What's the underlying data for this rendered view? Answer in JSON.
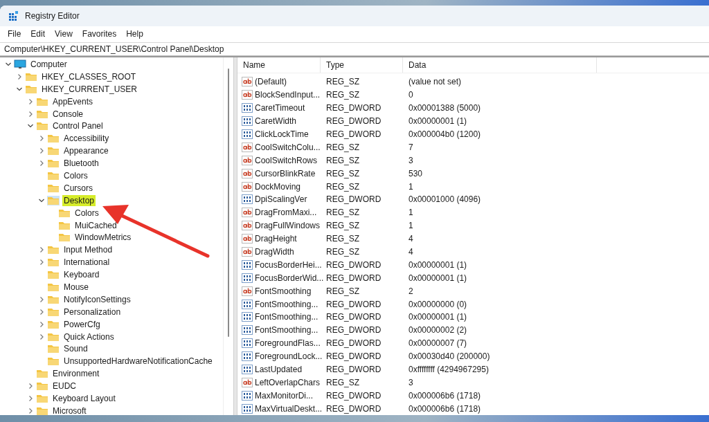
{
  "window": {
    "title": "Registry Editor"
  },
  "menu": [
    "File",
    "Edit",
    "View",
    "Favorites",
    "Help"
  ],
  "address": "Computer\\HKEY_CURRENT_USER\\Control Panel\\Desktop",
  "tree": [
    {
      "label": "Computer",
      "kind": "computer",
      "has_children": true,
      "expanded": true,
      "selected": false,
      "children": [
        {
          "label": "HKEY_CLASSES_ROOT",
          "kind": "folder",
          "has_children": true,
          "expanded": false,
          "selected": false
        },
        {
          "label": "HKEY_CURRENT_USER",
          "kind": "folder",
          "has_children": true,
          "expanded": true,
          "selected": false,
          "children": [
            {
              "label": "AppEvents",
              "kind": "folder",
              "has_children": true,
              "expanded": false,
              "selected": false
            },
            {
              "label": "Console",
              "kind": "folder",
              "has_children": true,
              "expanded": false,
              "selected": false
            },
            {
              "label": "Control Panel",
              "kind": "folder",
              "has_children": true,
              "expanded": true,
              "selected": false,
              "children": [
                {
                  "label": "Accessibility",
                  "kind": "folder",
                  "has_children": true,
                  "expanded": false,
                  "selected": false
                },
                {
                  "label": "Appearance",
                  "kind": "folder",
                  "has_children": true,
                  "expanded": false,
                  "selected": false
                },
                {
                  "label": "Bluetooth",
                  "kind": "folder",
                  "has_children": true,
                  "expanded": false,
                  "selected": false
                },
                {
                  "label": "Colors",
                  "kind": "folder",
                  "has_children": false,
                  "selected": false
                },
                {
                  "label": "Cursors",
                  "kind": "folder",
                  "has_children": false,
                  "selected": false
                },
                {
                  "label": "Desktop",
                  "kind": "folder",
                  "has_children": true,
                  "expanded": true,
                  "selected": true,
                  "children": [
                    {
                      "label": "Colors",
                      "kind": "folder",
                      "has_children": false,
                      "selected": false
                    },
                    {
                      "label": "MuiCached",
                      "kind": "folder",
                      "has_children": false,
                      "selected": false
                    },
                    {
                      "label": "WindowMetrics",
                      "kind": "folder",
                      "has_children": false,
                      "selected": false
                    }
                  ]
                },
                {
                  "label": "Input Method",
                  "kind": "folder",
                  "has_children": true,
                  "expanded": false,
                  "selected": false
                },
                {
                  "label": "International",
                  "kind": "folder",
                  "has_children": true,
                  "expanded": false,
                  "selected": false
                },
                {
                  "label": "Keyboard",
                  "kind": "folder",
                  "has_children": false,
                  "selected": false
                },
                {
                  "label": "Mouse",
                  "kind": "folder",
                  "has_children": false,
                  "selected": false
                },
                {
                  "label": "NotifyIconSettings",
                  "kind": "folder",
                  "has_children": true,
                  "expanded": false,
                  "selected": false
                },
                {
                  "label": "Personalization",
                  "kind": "folder",
                  "has_children": true,
                  "expanded": false,
                  "selected": false
                },
                {
                  "label": "PowerCfg",
                  "kind": "folder",
                  "has_children": true,
                  "expanded": false,
                  "selected": false
                },
                {
                  "label": "Quick Actions",
                  "kind": "folder",
                  "has_children": true,
                  "expanded": false,
                  "selected": false
                },
                {
                  "label": "Sound",
                  "kind": "folder",
                  "has_children": false,
                  "selected": false
                },
                {
                  "label": "UnsupportedHardwareNotificationCache",
                  "kind": "folder",
                  "has_children": false,
                  "selected": false
                }
              ]
            },
            {
              "label": "Environment",
              "kind": "folder",
              "has_children": false,
              "selected": false
            },
            {
              "label": "EUDC",
              "kind": "folder",
              "has_children": true,
              "expanded": false,
              "selected": false
            },
            {
              "label": "Keyboard Layout",
              "kind": "folder",
              "has_children": true,
              "expanded": false,
              "selected": false
            },
            {
              "label": "Microsoft",
              "kind": "folder",
              "has_children": true,
              "expanded": false,
              "selected": false
            }
          ]
        }
      ]
    }
  ],
  "table": {
    "columns": [
      "Name",
      "Type",
      "Data"
    ],
    "rows": [
      {
        "kind": "string",
        "name": "(Default)",
        "type": "REG_SZ",
        "data": "(value not set)"
      },
      {
        "kind": "string",
        "name": "BlockSendInput...",
        "type": "REG_SZ",
        "data": "0"
      },
      {
        "kind": "dword",
        "name": "CaretTimeout",
        "type": "REG_DWORD",
        "data": "0x00001388 (5000)"
      },
      {
        "kind": "dword",
        "name": "CaretWidth",
        "type": "REG_DWORD",
        "data": "0x00000001 (1)"
      },
      {
        "kind": "dword",
        "name": "ClickLockTime",
        "type": "REG_DWORD",
        "data": "0x000004b0 (1200)"
      },
      {
        "kind": "string",
        "name": "CoolSwitchColu...",
        "type": "REG_SZ",
        "data": "7"
      },
      {
        "kind": "string",
        "name": "CoolSwitchRows",
        "type": "REG_SZ",
        "data": "3"
      },
      {
        "kind": "string",
        "name": "CursorBlinkRate",
        "type": "REG_SZ",
        "data": "530"
      },
      {
        "kind": "string",
        "name": "DockMoving",
        "type": "REG_SZ",
        "data": "1"
      },
      {
        "kind": "dword",
        "name": "DpiScalingVer",
        "type": "REG_DWORD",
        "data": "0x00001000 (4096)"
      },
      {
        "kind": "string",
        "name": "DragFromMaxi...",
        "type": "REG_SZ",
        "data": "1"
      },
      {
        "kind": "string",
        "name": "DragFullWindows",
        "type": "REG_SZ",
        "data": "1"
      },
      {
        "kind": "string",
        "name": "DragHeight",
        "type": "REG_SZ",
        "data": "4"
      },
      {
        "kind": "string",
        "name": "DragWidth",
        "type": "REG_SZ",
        "data": "4"
      },
      {
        "kind": "dword",
        "name": "FocusBorderHei...",
        "type": "REG_DWORD",
        "data": "0x00000001 (1)"
      },
      {
        "kind": "dword",
        "name": "FocusBorderWid...",
        "type": "REG_DWORD",
        "data": "0x00000001 (1)"
      },
      {
        "kind": "string",
        "name": "FontSmoothing",
        "type": "REG_SZ",
        "data": "2"
      },
      {
        "kind": "dword",
        "name": "FontSmoothing...",
        "type": "REG_DWORD",
        "data": "0x00000000 (0)"
      },
      {
        "kind": "dword",
        "name": "FontSmoothing...",
        "type": "REG_DWORD",
        "data": "0x00000001 (1)"
      },
      {
        "kind": "dword",
        "name": "FontSmoothing...",
        "type": "REG_DWORD",
        "data": "0x00000002 (2)"
      },
      {
        "kind": "dword",
        "name": "ForegroundFlas...",
        "type": "REG_DWORD",
        "data": "0x00000007 (7)"
      },
      {
        "kind": "dword",
        "name": "ForegroundLock...",
        "type": "REG_DWORD",
        "data": "0x00030d40 (200000)"
      },
      {
        "kind": "dword",
        "name": "LastUpdated",
        "type": "REG_DWORD",
        "data": "0xffffffff (4294967295)"
      },
      {
        "kind": "string",
        "name": "LeftOverlapChars",
        "type": "REG_SZ",
        "data": "3"
      },
      {
        "kind": "dword",
        "name": "MaxMonitorDi...",
        "type": "REG_DWORD",
        "data": "0x000006b6 (1718)"
      },
      {
        "kind": "dword",
        "name": "MaxVirtualDeskt...",
        "type": "REG_DWORD",
        "data": "0x000006b6 (1718)"
      }
    ]
  }
}
